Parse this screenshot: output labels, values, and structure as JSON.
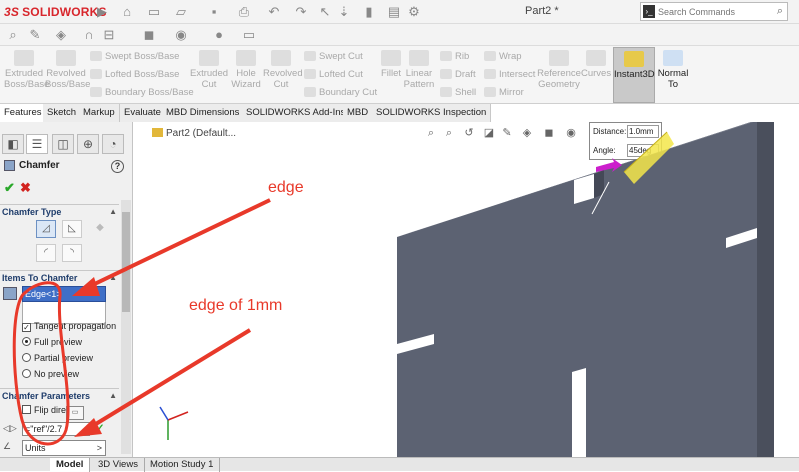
{
  "app": {
    "logo_prefix": "3S",
    "logo_text": "SOLIDWORKS",
    "document_title": "Part2 *",
    "search_placeholder": "Search Commands"
  },
  "ribbon": {
    "tools": [
      {
        "id": "extruded-boss",
        "label": "Extruded Boss/Base"
      },
      {
        "id": "revolved-boss",
        "label": "Revolved Boss/Base"
      },
      {
        "id": "extruded-cut",
        "label": "Extruded Cut"
      },
      {
        "id": "hole-wizard",
        "label": "Hole Wizard"
      },
      {
        "id": "revolved-cut",
        "label": "Revolved Cut"
      },
      {
        "id": "fillet",
        "label": "Fillet"
      },
      {
        "id": "linear-pattern",
        "label": "Linear Pattern"
      },
      {
        "id": "reference-geometry",
        "label": "Reference Geometry"
      },
      {
        "id": "curves",
        "label": "Curves"
      },
      {
        "id": "instant3d",
        "label": "Instant3D"
      },
      {
        "id": "normal-to",
        "label": "Normal To"
      }
    ],
    "small_tools": [
      {
        "id": "swept-boss",
        "label": "Swept Boss/Base"
      },
      {
        "id": "lofted-boss",
        "label": "Lofted Boss/Base"
      },
      {
        "id": "boundary-boss",
        "label": "Boundary Boss/Base"
      },
      {
        "id": "swept-cut",
        "label": "Swept Cut"
      },
      {
        "id": "lofted-cut",
        "label": "Lofted Cut"
      },
      {
        "id": "boundary-cut",
        "label": "Boundary Cut"
      },
      {
        "id": "rib",
        "label": "Rib"
      },
      {
        "id": "draft",
        "label": "Draft"
      },
      {
        "id": "shell",
        "label": "Shell"
      },
      {
        "id": "wrap",
        "label": "Wrap"
      },
      {
        "id": "intersect",
        "label": "Intersect"
      },
      {
        "id": "mirror",
        "label": "Mirror"
      }
    ]
  },
  "command_tabs": [
    "Features",
    "Sketch",
    "Markup",
    "Evaluate",
    "MBD Dimensions",
    "SOLIDWORKS Add-Ins",
    "MBD",
    "SOLIDWORKS Inspection"
  ],
  "property_manager": {
    "title": "Chamfer",
    "chamfer_type_header": "Chamfer Type",
    "items_header": "Items To Chamfer",
    "selected_item": "Edge<1>",
    "tangent_propagation": "Tangent propagation",
    "full_preview": "Full preview",
    "partial_preview": "Partial preview",
    "no_preview": "No preview",
    "params_header": "Chamfer Parameters",
    "flip_direction": "Flip direc",
    "formula": "=\"ref\"/2.7",
    "units": "Units"
  },
  "viewport": {
    "tree_root": "Part2 (Default...",
    "callout": {
      "distance_label": "Distance:",
      "distance_value": "1.0mm",
      "angle_label": "Angle:",
      "angle_value": "45deg"
    },
    "part_color": "#5c6272",
    "part_top_color": "#7a7f8d"
  },
  "annotations": {
    "edge": "edge",
    "edge_of_1mm": "edge of 1mm",
    "color": "#e8392a"
  },
  "bottom_tabs": [
    "Model",
    "3D Views",
    "Motion Study 1"
  ]
}
